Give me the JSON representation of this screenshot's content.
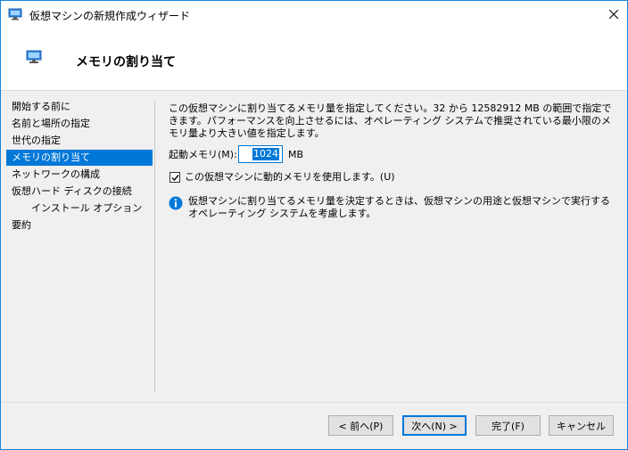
{
  "window": {
    "title": "仮想マシンの新規作成ウィザード"
  },
  "header": {
    "title": "メモリの割り当て"
  },
  "nav": {
    "items": [
      {
        "label": "開始する前に"
      },
      {
        "label": "名前と場所の指定"
      },
      {
        "label": "世代の指定"
      },
      {
        "label": "メモリの割り当て",
        "selected": true
      },
      {
        "label": "ネットワークの構成"
      },
      {
        "label": "仮想ハード ディスクの接続"
      },
      {
        "label": "インストール オプション",
        "sub": true
      },
      {
        "label": "要約"
      }
    ]
  },
  "content": {
    "description": "この仮想マシンに割り当てるメモリ量を指定してください。32 から 12582912 MB の範囲で指定できます。パフォーマンスを向上させるには、オペレーティング システムで推奨されている最小限のメモリ量より大きい値を指定します。",
    "memory_label": "起動メモリ(M):",
    "memory_value": "1024",
    "memory_unit": "MB",
    "dynamic_memory_label": "この仮想マシンに動的メモリを使用します。(U)",
    "dynamic_memory_checked": true,
    "info_text": "仮想マシンに割り当てるメモリ量を決定するときは、仮想マシンの用途と仮想マシンで実行するオペレーティング システムを考慮します。"
  },
  "buttons": {
    "back": "< 前へ(P)",
    "next": "次へ(N) >",
    "finish": "完了(F)",
    "cancel": "キャンセル"
  },
  "colors": {
    "accent": "#0078d7",
    "info": "#0078d7"
  },
  "icons": {
    "window": "vm-icon",
    "close": "close-icon",
    "info": "info-icon"
  }
}
